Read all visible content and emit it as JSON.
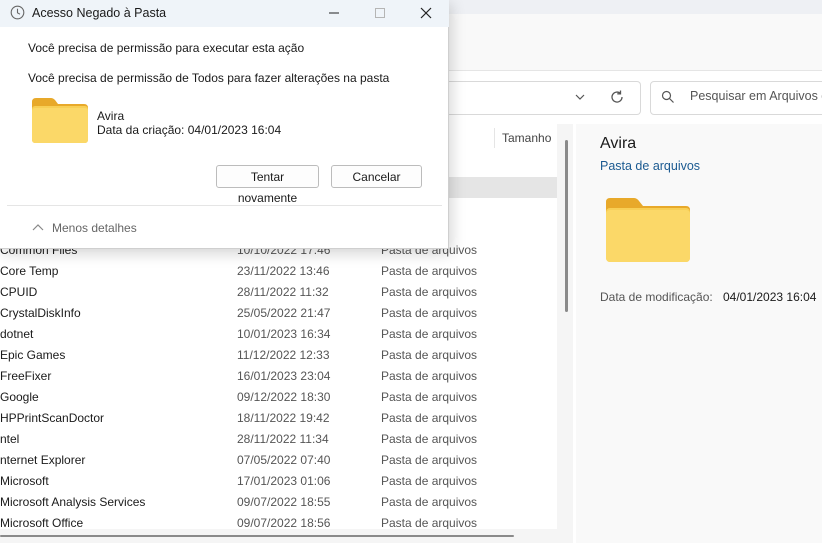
{
  "dialog": {
    "title": "Acesso Negado à Pasta",
    "message1": "Você precisa de permissão para executar esta ação",
    "message2": "Você precisa de permissão de Todos para fazer alterações na pasta",
    "folder_name": "Avira",
    "folder_date": "Data da criação: 04/01/2023 16:04",
    "retry_label": "Tentar novamente",
    "cancel_label": "Cancelar",
    "less_details_label": "Menos detalhes"
  },
  "explorer": {
    "search_placeholder": "Pesquisar em Arquivos de",
    "column_size": "Tamanho",
    "partial_types": [
      "quivos",
      "quivos",
      "quivos"
    ],
    "rows": [
      {
        "name": "Common Files",
        "date": "10/10/2022 17:46",
        "type": "Pasta de arquivos"
      },
      {
        "name": "Core Temp",
        "date": "23/11/2022 13:46",
        "type": "Pasta de arquivos"
      },
      {
        "name": "CPUID",
        "date": "28/11/2022 11:32",
        "type": "Pasta de arquivos"
      },
      {
        "name": "CrystalDiskInfo",
        "date": "25/05/2022 21:47",
        "type": "Pasta de arquivos"
      },
      {
        "name": "dotnet",
        "date": "10/01/2023 16:34",
        "type": "Pasta de arquivos"
      },
      {
        "name": "Epic Games",
        "date": "11/12/2022 12:33",
        "type": "Pasta de arquivos"
      },
      {
        "name": "FreeFixer",
        "date": "16/01/2023 23:04",
        "type": "Pasta de arquivos"
      },
      {
        "name": "Google",
        "date": "09/12/2022 18:30",
        "type": "Pasta de arquivos"
      },
      {
        "name": "HPPrintScanDoctor",
        "date": "18/11/2022 19:42",
        "type": "Pasta de arquivos"
      },
      {
        "name": "ntel",
        "date": "28/11/2022 11:34",
        "type": "Pasta de arquivos"
      },
      {
        "name": "nternet Explorer",
        "date": "07/05/2022 07:40",
        "type": "Pasta de arquivos"
      },
      {
        "name": "Microsoft",
        "date": "17/01/2023 01:06",
        "type": "Pasta de arquivos"
      },
      {
        "name": "Microsoft Analysis Services",
        "date": "09/07/2022 18:55",
        "type": "Pasta de arquivos"
      },
      {
        "name": "Microsoft Office",
        "date": "09/07/2022 18:56",
        "type": "Pasta de arquivos"
      }
    ],
    "details": {
      "name": "Avira",
      "type": "Pasta de arquivos",
      "modified_label": "Data de modificação:",
      "modified_value": "04/01/2023 16:04"
    }
  },
  "colors": {
    "accent_link": "#1b5a91",
    "folder_yellow": "#f6c444",
    "selected_row": "#e5e5e5"
  },
  "icons": [
    "clock-icon",
    "minimize-icon",
    "maximize-icon",
    "close-icon",
    "folder-icon",
    "chevron-up-icon",
    "chevron-down-icon",
    "refresh-icon",
    "search-icon"
  ]
}
